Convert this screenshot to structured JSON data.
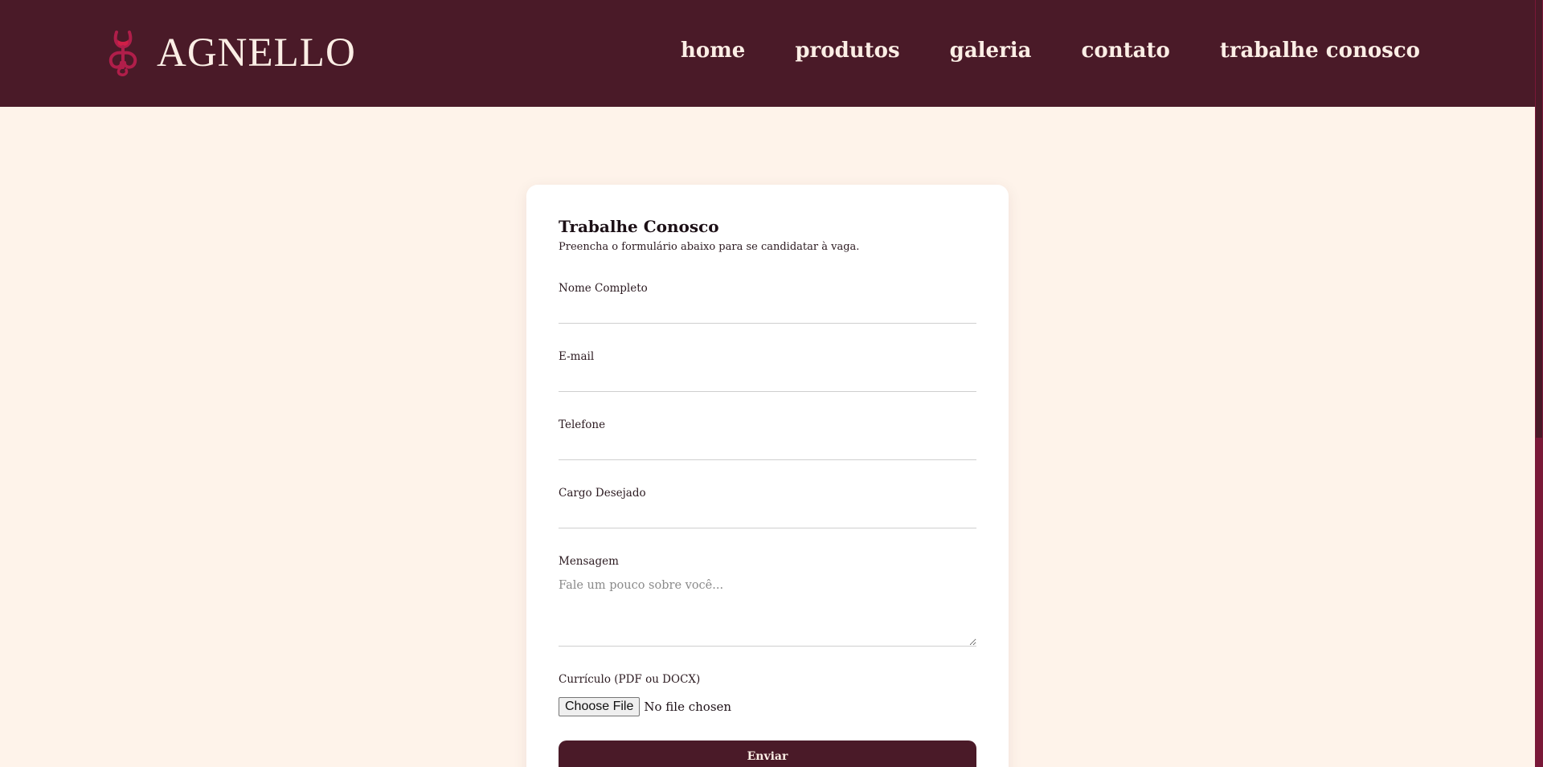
{
  "brand": {
    "name": "AGNELLO",
    "icon": "wine-glass-logo-icon"
  },
  "nav": {
    "items": [
      {
        "label": "home"
      },
      {
        "label": "produtos"
      },
      {
        "label": "galeria"
      },
      {
        "label": "contato"
      },
      {
        "label": "trabalhe conosco"
      }
    ]
  },
  "form": {
    "title": "Trabalhe Conosco",
    "subtitle": "Preencha o formulário abaixo para se candidatar à vaga.",
    "fields": {
      "name": {
        "label": "Nome Completo",
        "value": ""
      },
      "email": {
        "label": "E-mail",
        "value": ""
      },
      "phone": {
        "label": "Telefone",
        "value": ""
      },
      "position": {
        "label": "Cargo Desejado",
        "value": ""
      },
      "message": {
        "label": "Mensagem",
        "placeholder": "Fale um pouco sobre você...",
        "value": ""
      },
      "resume": {
        "label": "Currículo (PDF ou DOCX)",
        "button_label": "Choose File",
        "status": "No file chosen"
      }
    },
    "submit_label": "Enviar"
  },
  "colors": {
    "header_bg": "#4a1a28",
    "page_bg": "#fef3ea",
    "card_bg": "#ffffff",
    "accent": "#b01e4a",
    "nav_text": "#fbeee5"
  }
}
